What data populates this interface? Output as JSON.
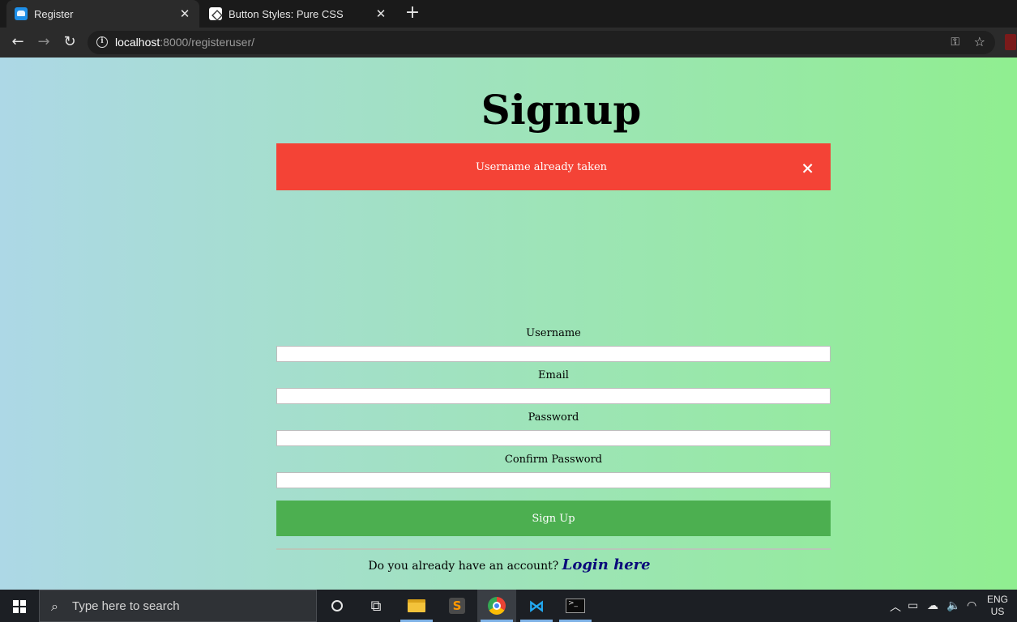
{
  "browser": {
    "tabs": [
      {
        "title": "Register",
        "favicon": "register-favicon",
        "active": true
      },
      {
        "title": "Button Styles: Pure CSS",
        "favicon": "codepen-favicon",
        "active": false
      }
    ],
    "url": {
      "host": "localhost",
      "path": ":8000/registeruser/"
    },
    "icons": [
      "back-icon",
      "forward-icon",
      "reload-icon",
      "info-icon",
      "key-icon",
      "star-icon"
    ]
  },
  "page": {
    "title": "Signup",
    "alert": {
      "message": "Username already taken",
      "close": "×",
      "color": "#f44336"
    },
    "fields": [
      {
        "label": "Username",
        "value": ""
      },
      {
        "label": "Email",
        "value": ""
      },
      {
        "label": "Password",
        "value": ""
      },
      {
        "label": "Confirm Password",
        "value": ""
      }
    ],
    "submit_label": "Sign Up",
    "submit_color": "#4caf50",
    "login_prompt": "Do you already have an account?",
    "login_link": "Login here",
    "gradient": [
      "#add8e6",
      "#90ee90"
    ]
  },
  "taskbar": {
    "search_placeholder": "Type here to search",
    "apps": [
      "cortana-icon",
      "task-view-icon",
      "file-explorer-icon",
      "sublime-text-icon",
      "chrome-icon",
      "vscode-icon",
      "terminal-icon"
    ],
    "tray": {
      "lang_line1": "ENG",
      "lang_line2": "US"
    }
  }
}
